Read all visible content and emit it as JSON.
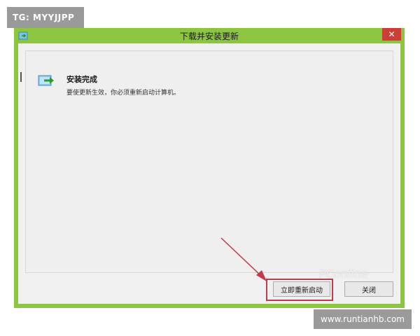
{
  "watermark": {
    "tg_label": "TG: MYYJJPP",
    "site_label": "www.runtianhb.com",
    "logo_text": "PConline"
  },
  "window": {
    "title": "下载并安装更新",
    "close_symbol": "✕",
    "accent_color": "#8cc640"
  },
  "content": {
    "icon": "update-shield-arrow-icon",
    "heading": "安装完成",
    "message": "要使更新生效，你必须重新启动计算机。"
  },
  "buttons": {
    "restart_label": "立即重新启动",
    "close_label": "关闭"
  }
}
